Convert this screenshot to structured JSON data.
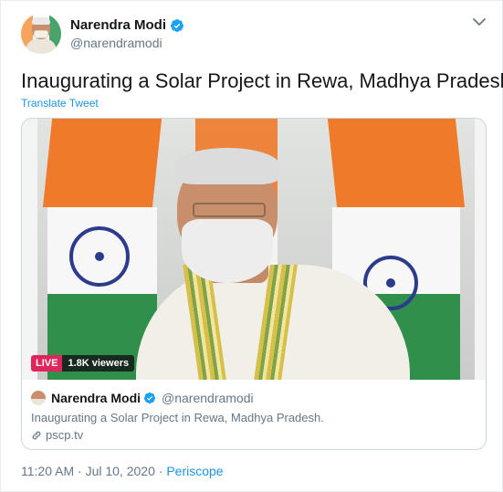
{
  "author": {
    "display_name": "Narendra Modi",
    "handle": "@narendramodi",
    "verified": true,
    "avatar_icon": "profile-avatar"
  },
  "tweet": {
    "text": "Inaugurating a Solar Project in Rewa, Madhya Pradesh.",
    "translate_label": "Translate Tweet"
  },
  "card": {
    "live_label": "LIVE",
    "viewers": "1.8K viewers",
    "author_name": "Narendra Modi",
    "author_handle": "@narendramodi",
    "description": "Inaugurating a Solar Project in Rewa, Madhya Pradesh.",
    "link": "pscp.tv"
  },
  "meta": {
    "time": "11:20 AM",
    "separator": " · ",
    "date": "Jul 10, 2020",
    "source": "Periscope"
  },
  "colors": {
    "link_blue": "#1b95e0",
    "live_red": "#e0245e",
    "secondary_text": "#657786"
  }
}
